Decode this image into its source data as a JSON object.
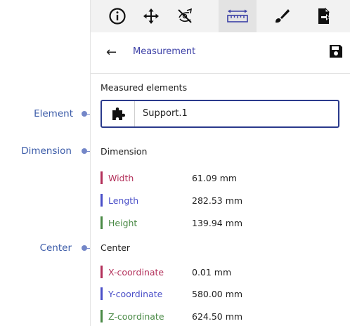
{
  "toolbar": {
    "tools": [
      {
        "icon": "info-icon"
      },
      {
        "icon": "move-icon"
      },
      {
        "icon": "hide-icon"
      },
      {
        "icon": "ruler-icon",
        "active": true
      },
      {
        "icon": "brush-icon"
      },
      {
        "icon": "export-document-icon"
      }
    ]
  },
  "header": {
    "title": "Measurement",
    "back_icon": "←",
    "save_icon": "save-icon"
  },
  "measured_elements": {
    "heading": "Measured elements",
    "element_name": "Support.1",
    "element_icon": "puzzle-piece-icon"
  },
  "dimension": {
    "heading": "Dimension",
    "rows": [
      {
        "label": "Width",
        "value": "61.09 mm",
        "color": "#b3305a"
      },
      {
        "label": "Length",
        "value": "282.53 mm",
        "color": "#4a4fc8"
      },
      {
        "label": "Height",
        "value": "139.94 mm",
        "color": "#4a8a46"
      }
    ]
  },
  "center": {
    "heading": "Center",
    "rows": [
      {
        "label": "X-coordinate",
        "value": "0.01 mm",
        "color": "#b3305a"
      },
      {
        "label": "Y-coordinate",
        "value": "580.00 mm",
        "color": "#4a4fc8"
      },
      {
        "label": "Z-coordinate",
        "value": "624.50 mm",
        "color": "#4a8a46"
      }
    ]
  },
  "callouts": {
    "element": "Element",
    "dimension": "Dimension",
    "center": "Center"
  },
  "colors": {
    "accent": "#2a3a8c",
    "callout": "#3b5ba8"
  }
}
